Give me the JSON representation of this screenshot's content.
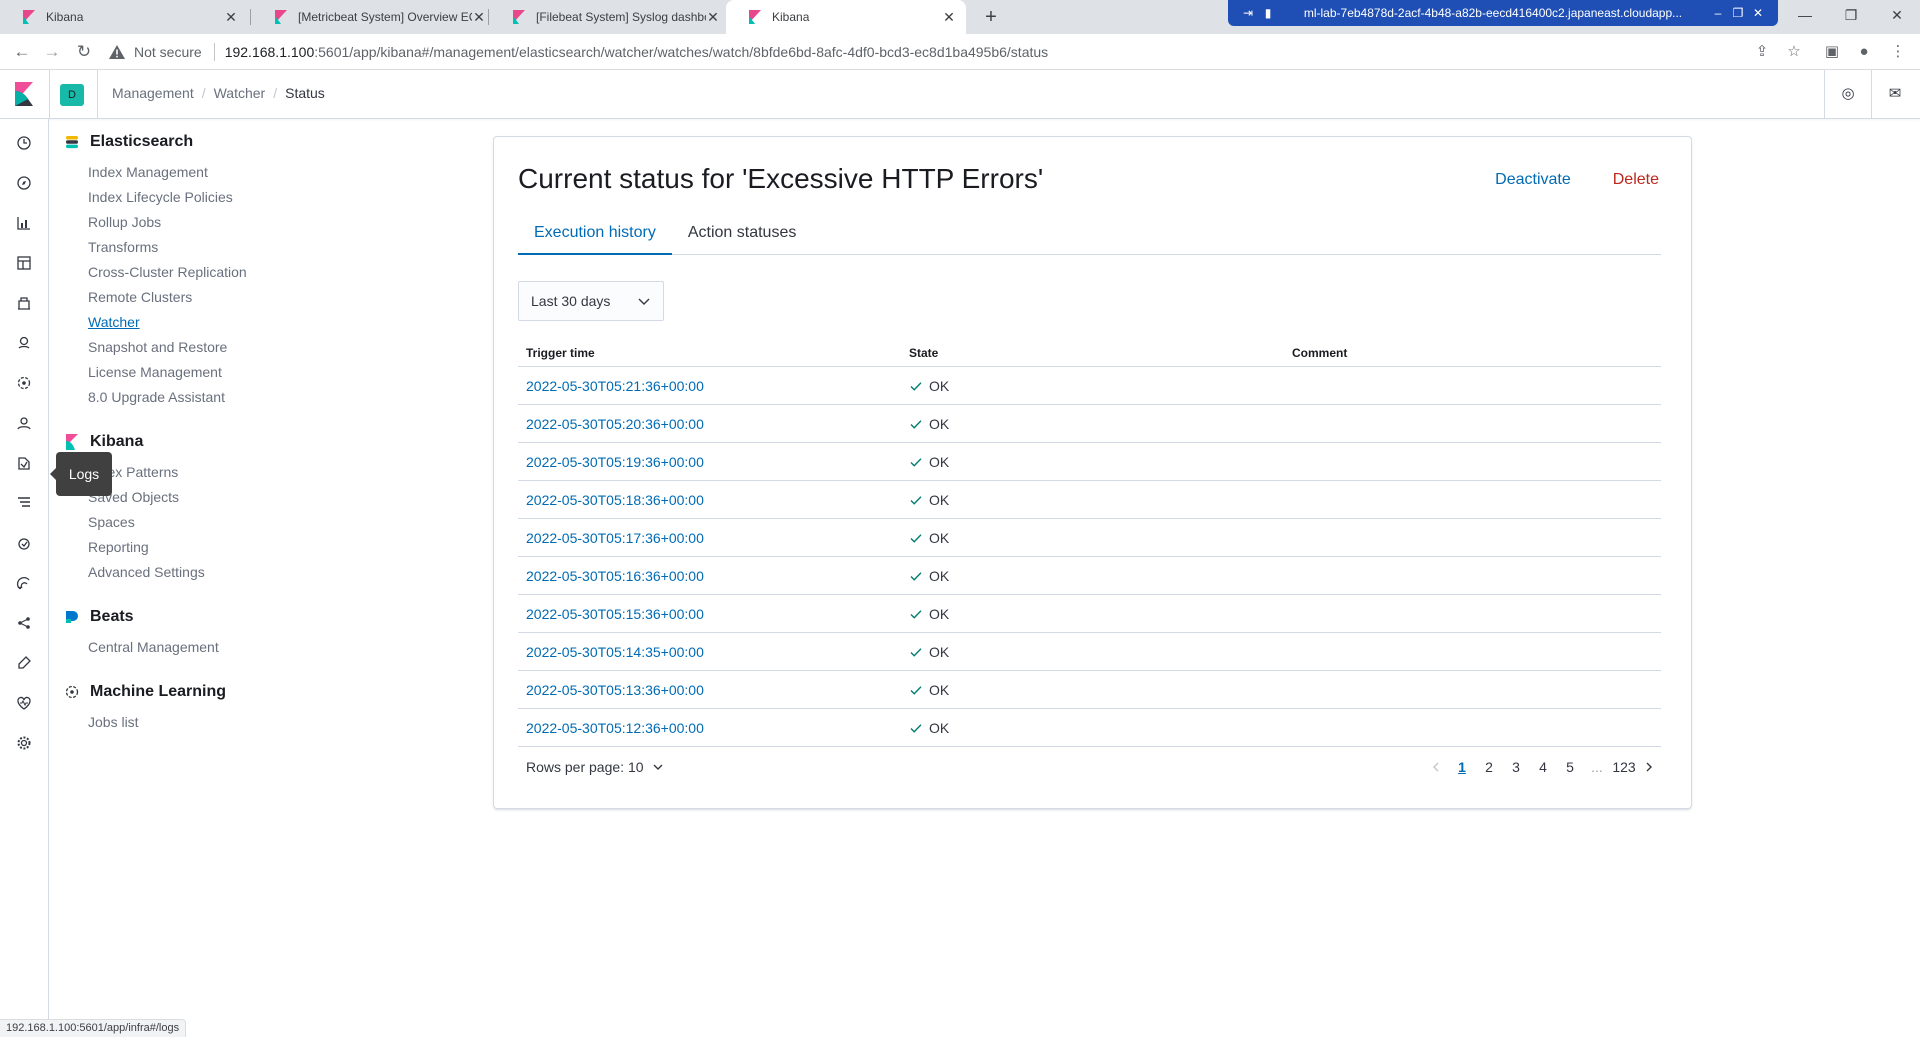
{
  "browser": {
    "tabs": [
      {
        "title": "Kibana",
        "active": false
      },
      {
        "title": "[Metricbeat System] Overview EC",
        "active": false
      },
      {
        "title": "[Filebeat System] Syslog dashboa",
        "active": false
      },
      {
        "title": "Kibana",
        "active": true
      }
    ],
    "remote_session_title": "ml-lab-7eb4878d-2acf-4b48-a82b-eecd416400c2.japaneast.cloudapp...",
    "security_label": "Not secure",
    "url_host": "192.168.1.100",
    "url_rest": ":5601/app/kibana#/management/elasticsearch/watcher/watches/watch/8bfde6bd-8afc-4df0-bcd3-ec8d1ba495b6/status",
    "status_url": "192.168.1.100:5601/app/infra#/logs"
  },
  "header": {
    "space_initial": "D",
    "breadcrumbs": [
      "Management",
      "Watcher",
      "Status"
    ]
  },
  "icon_nav": {
    "tooltip": "Logs"
  },
  "sidebar": {
    "groups": [
      {
        "title": "Elasticsearch",
        "items": [
          "Index Management",
          "Index Lifecycle Policies",
          "Rollup Jobs",
          "Transforms",
          "Cross-Cluster Replication",
          "Remote Clusters",
          "Watcher",
          "Snapshot and Restore",
          "License Management",
          "8.0 Upgrade Assistant"
        ]
      },
      {
        "title": "Kibana",
        "items": [
          "Index Patterns",
          "Saved Objects",
          "Spaces",
          "Reporting",
          "Advanced Settings"
        ]
      },
      {
        "title": "Beats",
        "items": [
          "Central Management"
        ]
      },
      {
        "title": "Machine Learning",
        "items": [
          "Jobs list"
        ]
      }
    ],
    "selected_item": "Watcher"
  },
  "main": {
    "title": "Current status for 'Excessive HTTP Errors'",
    "deactivate_label": "Deactivate",
    "delete_label": "Delete",
    "tabs": [
      "Execution history",
      "Action statuses"
    ],
    "range_select": "Last 30 days",
    "table": {
      "columns": [
        "Trigger time",
        "State",
        "Comment"
      ],
      "rows": [
        {
          "trigger_time": "2022-05-30T05:21:36+00:00",
          "state": "OK",
          "comment": ""
        },
        {
          "trigger_time": "2022-05-30T05:20:36+00:00",
          "state": "OK",
          "comment": ""
        },
        {
          "trigger_time": "2022-05-30T05:19:36+00:00",
          "state": "OK",
          "comment": ""
        },
        {
          "trigger_time": "2022-05-30T05:18:36+00:00",
          "state": "OK",
          "comment": ""
        },
        {
          "trigger_time": "2022-05-30T05:17:36+00:00",
          "state": "OK",
          "comment": ""
        },
        {
          "trigger_time": "2022-05-30T05:16:36+00:00",
          "state": "OK",
          "comment": ""
        },
        {
          "trigger_time": "2022-05-30T05:15:36+00:00",
          "state": "OK",
          "comment": ""
        },
        {
          "trigger_time": "2022-05-30T05:14:35+00:00",
          "state": "OK",
          "comment": ""
        },
        {
          "trigger_time": "2022-05-30T05:13:36+00:00",
          "state": "OK",
          "comment": ""
        },
        {
          "trigger_time": "2022-05-30T05:12:36+00:00",
          "state": "OK",
          "comment": ""
        }
      ]
    },
    "rows_per_page_label": "Rows per page: 10",
    "pagination": {
      "pages": [
        "1",
        "2",
        "3",
        "4",
        "5",
        "...",
        "123"
      ],
      "active_page": "1"
    }
  },
  "colors": {
    "link": "#006bb4",
    "danger": "#bd271e",
    "success": "#017d73",
    "space_badge": "#17b9a8"
  }
}
